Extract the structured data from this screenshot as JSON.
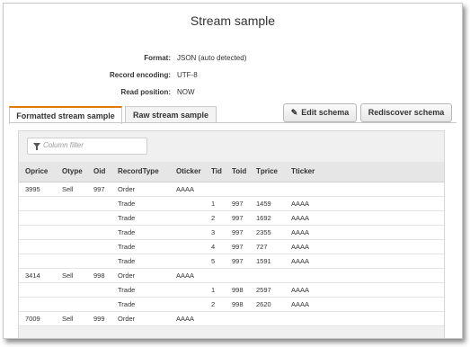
{
  "title": "Stream sample",
  "meta": [
    {
      "label": "Format:",
      "value": "JSON (auto detected)"
    },
    {
      "label": "Record encoding:",
      "value": "UTF-8"
    },
    {
      "label": "Read position:",
      "value": "NOW"
    }
  ],
  "tabs": [
    {
      "label": "Formatted stream sample",
      "active": true
    },
    {
      "label": "Raw stream sample",
      "active": false
    }
  ],
  "buttons": {
    "edit_schema": "Edit schema",
    "rediscover_schema": "Rediscover schema"
  },
  "filter": {
    "placeholder": "Column filter"
  },
  "table": {
    "columns": [
      "Oprice",
      "Otype",
      "Oid",
      "RecordType",
      "Oticker",
      "Tid",
      "Toid",
      "Tprice",
      "Tticker"
    ],
    "rows": [
      [
        "3995",
        "Sell",
        "997",
        "Order",
        "AAAA",
        "",
        "",
        "",
        ""
      ],
      [
        "",
        "",
        "",
        "Trade",
        "",
        "1",
        "997",
        "1459",
        "AAAA"
      ],
      [
        "",
        "",
        "",
        "Trade",
        "",
        "2",
        "997",
        "1692",
        "AAAA"
      ],
      [
        "",
        "",
        "",
        "Trade",
        "",
        "3",
        "997",
        "2355",
        "AAAA"
      ],
      [
        "",
        "",
        "",
        "Trade",
        "",
        "4",
        "997",
        "727",
        "AAAA"
      ],
      [
        "",
        "",
        "",
        "Trade",
        "",
        "5",
        "997",
        "1591",
        "AAAA"
      ],
      [
        "3414",
        "Sell",
        "998",
        "Order",
        "AAAA",
        "",
        "",
        "",
        ""
      ],
      [
        "",
        "",
        "",
        "Trade",
        "",
        "1",
        "998",
        "2597",
        "AAAA"
      ],
      [
        "",
        "",
        "",
        "Trade",
        "",
        "2",
        "998",
        "2620",
        "AAAA"
      ],
      [
        "7009",
        "Sell",
        "999",
        "Order",
        "AAAA",
        "",
        "",
        "",
        ""
      ]
    ]
  },
  "colors": {
    "active_tab_accent": "#e07b00"
  }
}
